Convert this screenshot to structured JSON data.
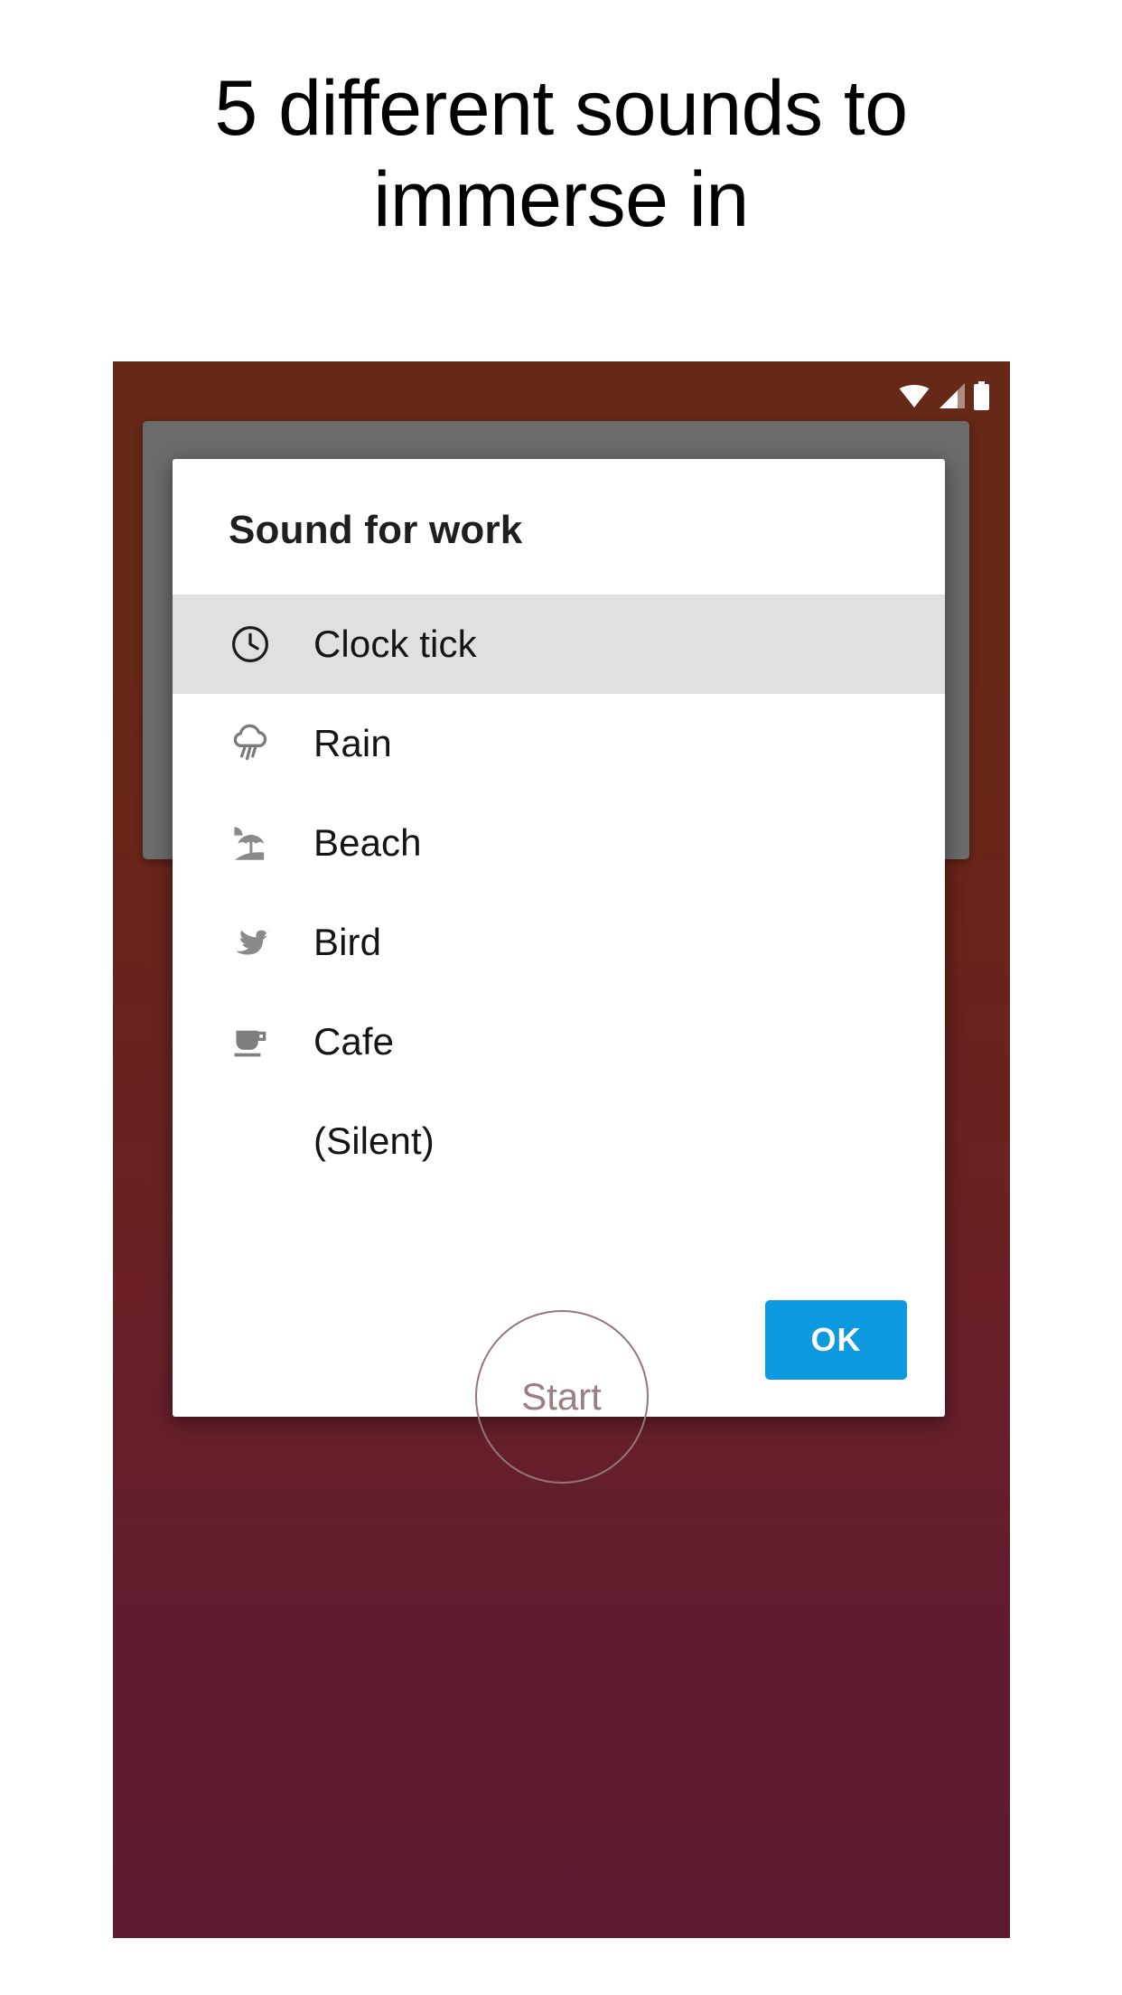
{
  "headline": "5 different sounds to immerse in",
  "phone": {
    "background_top_color": "#662817",
    "background_bottom_color": "#5c1b2e",
    "status_bar": {
      "wifi_icon": "wifi-icon",
      "signal_icon": "cell-signal-icon",
      "battery_icon": "battery-full-icon"
    },
    "music_note_icon": "music-note-icon",
    "start_button": {
      "label": "Start"
    }
  },
  "dialog": {
    "title": "Sound for work",
    "accent_color": "#0d99e0",
    "selected_row_color": "#e0e0e0",
    "sounds": [
      {
        "label": "Clock tick",
        "icon": "clock-icon",
        "selected": true
      },
      {
        "label": "Rain",
        "icon": "rain-cloud-icon",
        "selected": false
      },
      {
        "label": "Beach",
        "icon": "beach-umbrella-icon",
        "selected": false
      },
      {
        "label": "Bird",
        "icon": "bird-icon",
        "selected": false
      },
      {
        "label": "Cafe",
        "icon": "coffee-cup-icon",
        "selected": false
      },
      {
        "label": "(Silent)",
        "icon": "",
        "selected": false
      }
    ],
    "ok_label": "OK"
  }
}
